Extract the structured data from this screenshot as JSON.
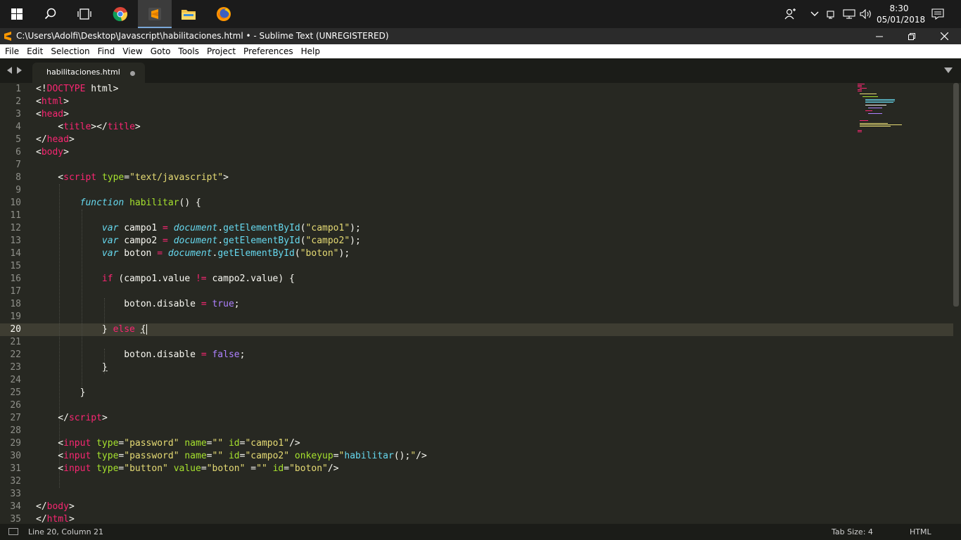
{
  "colors": {
    "background": "#272822",
    "tag": "#f92672",
    "attribute": "#a6e22e",
    "string": "#e6db74",
    "keyword": "#66d9ef",
    "constant": "#ae81ff",
    "comment_gutter": "#8f908a"
  },
  "taskbar": {
    "icons": [
      "windows-start-icon",
      "search-icon",
      "task-view-icon",
      "chrome-icon",
      "sublime-text-icon",
      "file-explorer-icon",
      "firefox-icon"
    ],
    "tray_icons": [
      "people-icon",
      "chevron-up-icon",
      "network-icon",
      "monitor-icon",
      "volume-icon",
      "notifications-icon"
    ],
    "time": "8:30",
    "date": "05/01/2018"
  },
  "window": {
    "title": "C:\\Users\\Adolfi\\Desktop\\Javascript\\habilitaciones.html • - Sublime Text (UNREGISTERED)"
  },
  "menu": [
    {
      "label": "File"
    },
    {
      "label": "Edit"
    },
    {
      "label": "Selection"
    },
    {
      "label": "Find"
    },
    {
      "label": "View"
    },
    {
      "label": "Goto"
    },
    {
      "label": "Tools"
    },
    {
      "label": "Project"
    },
    {
      "label": "Preferences"
    },
    {
      "label": "Help"
    }
  ],
  "tab": {
    "label": "habilitaciones.html",
    "unsaved": true
  },
  "editor": {
    "line_numbers": [
      "1",
      "2",
      "3",
      "4",
      "5",
      "6",
      "7",
      "8",
      "9",
      "10",
      "11",
      "12",
      "13",
      "14",
      "15",
      "16",
      "17",
      "18",
      "19",
      "20",
      "21",
      "22",
      "23",
      "24",
      "25",
      "26",
      "27",
      "28",
      "29",
      "30",
      "31",
      "32",
      "33",
      "34",
      "35"
    ],
    "current_line": "20"
  },
  "status": {
    "position": "Line 20, Column 21",
    "tab_size": "Tab Size: 4",
    "syntax": "HTML"
  }
}
